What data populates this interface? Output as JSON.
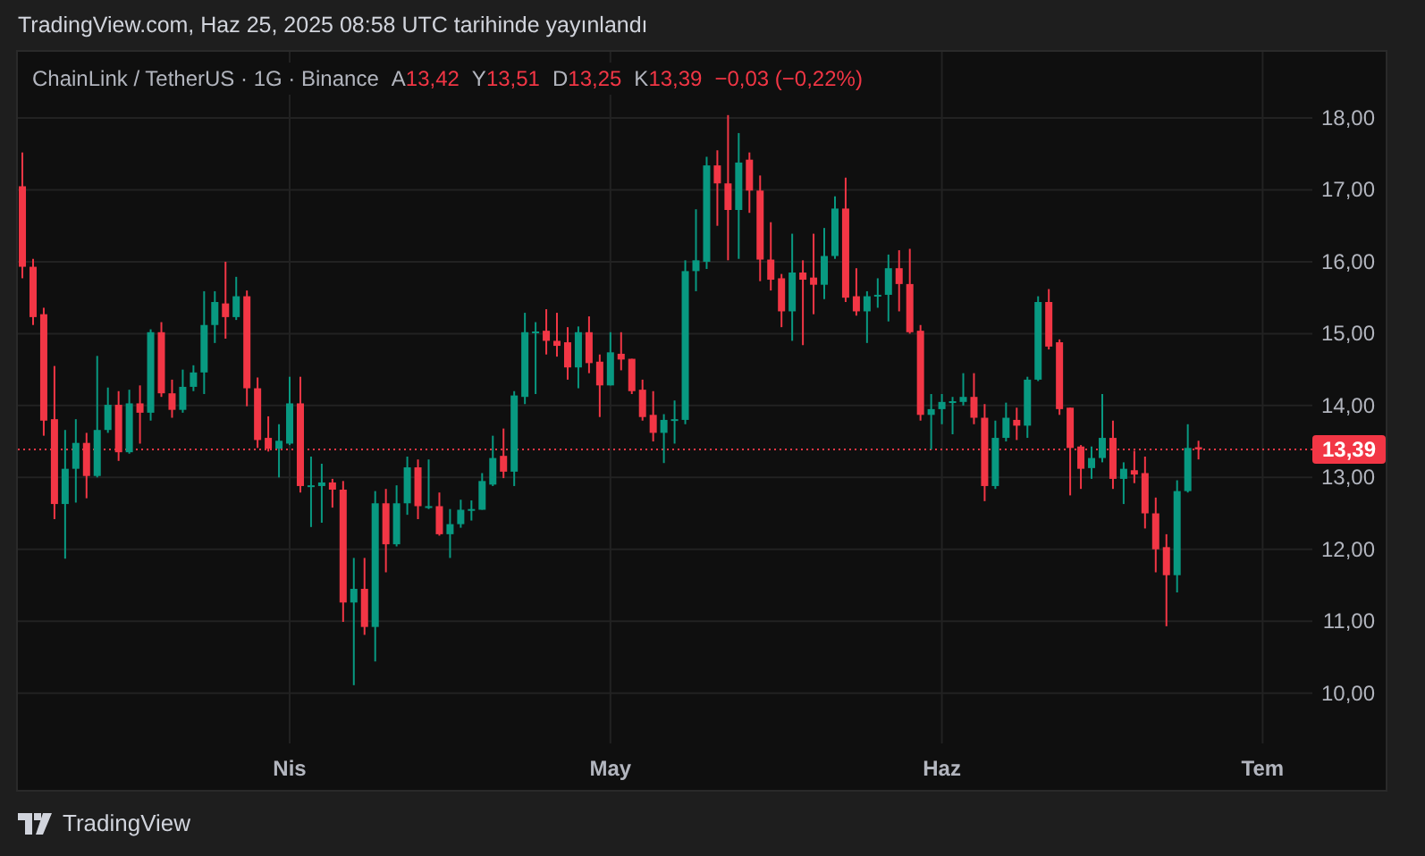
{
  "header": {
    "title": "TradingView.com, Haz 25, 2025 08:58 UTC tarihinde yayınlandı"
  },
  "chart": {
    "symbol": "ChainLink / TetherUS · 1G · Binance",
    "ohlc": [
      {
        "label": "A",
        "value": "13,42"
      },
      {
        "label": "Y",
        "value": "13,51"
      },
      {
        "label": "D",
        "value": "13,25"
      },
      {
        "label": "K",
        "value": "13,39"
      }
    ],
    "change": "−0,03 (−0,22%)",
    "last_price_label": "13,39",
    "chart_data": {
      "type": "candlestick",
      "ylim": [
        9.3,
        18.92
      ],
      "grid": true,
      "yticks": [
        {
          "value": 18,
          "label": "18,00"
        },
        {
          "value": 17,
          "label": "17,00"
        },
        {
          "value": 16,
          "label": "16,00"
        },
        {
          "value": 15,
          "label": "15,00"
        },
        {
          "value": 14,
          "label": "14,00"
        },
        {
          "value": 13,
          "label": "13,00"
        },
        {
          "value": 12,
          "label": "12,00"
        },
        {
          "value": 11,
          "label": "11,00"
        },
        {
          "value": 10,
          "label": "10,00"
        }
      ],
      "categories": [
        null,
        null,
        null,
        null,
        null,
        null,
        null,
        null,
        null,
        null,
        null,
        null,
        null,
        null,
        null,
        null,
        null,
        null,
        null,
        null,
        null,
        null,
        null,
        null,
        null,
        "Nis",
        null,
        null,
        null,
        null,
        null,
        null,
        null,
        null,
        null,
        null,
        null,
        null,
        null,
        null,
        null,
        null,
        null,
        null,
        null,
        null,
        null,
        null,
        null,
        null,
        null,
        null,
        null,
        null,
        null,
        "May",
        null,
        null,
        null,
        null,
        null,
        null,
        null,
        null,
        null,
        null,
        null,
        null,
        null,
        null,
        null,
        null,
        null,
        null,
        null,
        null,
        null,
        null,
        null,
        null,
        null,
        null,
        null,
        null,
        null,
        null,
        "Haz",
        null,
        null,
        null,
        null,
        null,
        null,
        null,
        null,
        null,
        null,
        null,
        null,
        null,
        null,
        null,
        null,
        null,
        null,
        null,
        null,
        null,
        null,
        null,
        null,
        null,
        null,
        null,
        null,
        null,
        "Tem",
        null,
        null,
        null,
        null
      ],
      "ref_lines": [
        {
          "axis": "y",
          "value": 13.39
        }
      ],
      "ohlc": [
        [
          17.05,
          17.52,
          15.77,
          15.93
        ],
        [
          15.93,
          16.04,
          15.12,
          15.23
        ],
        [
          15.27,
          15.36,
          13.58,
          13.79
        ],
        [
          13.81,
          14.55,
          12.42,
          12.63
        ],
        [
          12.63,
          13.66,
          11.87,
          13.12
        ],
        [
          13.12,
          13.81,
          12.65,
          13.48
        ],
        [
          13.48,
          13.62,
          12.71,
          13.02
        ],
        [
          13.02,
          14.69,
          13.0,
          13.66
        ],
        [
          13.66,
          14.25,
          13.62,
          14.01
        ],
        [
          14.01,
          14.2,
          13.23,
          13.35
        ],
        [
          13.35,
          14.22,
          13.33,
          14.03
        ],
        [
          14.03,
          14.28,
          13.47,
          13.9
        ],
        [
          13.9,
          15.06,
          13.79,
          15.02
        ],
        [
          15.02,
          15.16,
          14.12,
          14.17
        ],
        [
          14.17,
          14.36,
          13.83,
          13.94
        ],
        [
          13.94,
          14.5,
          13.9,
          14.26
        ],
        [
          14.26,
          14.56,
          14.2,
          14.46
        ],
        [
          14.46,
          15.59,
          14.16,
          15.12
        ],
        [
          15.12,
          15.59,
          14.87,
          15.44
        ],
        [
          15.42,
          16.0,
          14.93,
          15.23
        ],
        [
          15.23,
          15.79,
          15.19,
          15.52
        ],
        [
          15.52,
          15.6,
          13.99,
          14.24
        ],
        [
          14.24,
          14.39,
          13.41,
          13.52
        ],
        [
          13.55,
          13.85,
          13.36,
          13.4
        ],
        [
          13.4,
          13.74,
          13.0,
          13.51
        ],
        [
          13.47,
          14.4,
          13.45,
          14.03
        ],
        [
          14.03,
          14.4,
          12.79,
          12.88
        ],
        [
          12.88,
          13.29,
          12.31,
          12.89
        ],
        [
          12.88,
          13.19,
          12.37,
          12.93
        ],
        [
          12.93,
          12.98,
          12.58,
          12.83
        ],
        [
          12.83,
          12.95,
          10.99,
          11.26
        ],
        [
          11.26,
          11.88,
          10.11,
          11.45
        ],
        [
          11.45,
          11.88,
          10.81,
          10.92
        ],
        [
          10.92,
          12.81,
          10.44,
          12.64
        ],
        [
          12.64,
          12.84,
          11.68,
          12.07
        ],
        [
          12.07,
          12.89,
          12.04,
          12.64
        ],
        [
          12.64,
          13.29,
          12.48,
          13.14
        ],
        [
          13.14,
          13.25,
          12.42,
          12.6
        ],
        [
          12.58,
          13.25,
          12.56,
          12.6
        ],
        [
          12.6,
          12.79,
          12.19,
          12.21
        ],
        [
          12.21,
          12.56,
          11.88,
          12.35
        ],
        [
          12.35,
          12.69,
          12.3,
          12.55
        ],
        [
          12.55,
          12.68,
          12.4,
          12.56
        ],
        [
          12.55,
          13.06,
          12.55,
          12.95
        ],
        [
          12.9,
          13.58,
          12.88,
          13.27
        ],
        [
          13.3,
          13.68,
          12.99,
          13.08
        ],
        [
          13.08,
          14.2,
          12.88,
          14.14
        ],
        [
          14.12,
          15.29,
          14.02,
          15.02
        ],
        [
          15.02,
          15.16,
          14.16,
          15.03
        ],
        [
          15.04,
          15.34,
          14.71,
          14.9
        ],
        [
          14.9,
          15.29,
          14.68,
          14.83
        ],
        [
          14.88,
          15.09,
          14.36,
          14.53
        ],
        [
          14.53,
          15.1,
          14.24,
          15.02
        ],
        [
          15.02,
          15.24,
          14.45,
          14.59
        ],
        [
          14.61,
          14.71,
          13.84,
          14.28
        ],
        [
          14.28,
          15.02,
          14.28,
          14.74
        ],
        [
          14.72,
          15.02,
          14.49,
          14.64
        ],
        [
          14.65,
          14.65,
          14.16,
          14.2
        ],
        [
          14.22,
          14.36,
          13.79,
          13.84
        ],
        [
          13.87,
          14.2,
          13.5,
          13.62
        ],
        [
          13.62,
          13.88,
          13.2,
          13.8
        ],
        [
          13.8,
          14.07,
          13.47,
          13.81
        ],
        [
          13.8,
          16.02,
          13.74,
          15.87
        ],
        [
          15.87,
          16.73,
          15.59,
          16.02
        ],
        [
          16.0,
          17.46,
          15.9,
          17.34
        ],
        [
          17.34,
          17.55,
          16.5,
          17.09
        ],
        [
          17.09,
          18.04,
          16.02,
          16.72
        ],
        [
          16.72,
          17.79,
          16.04,
          17.38
        ],
        [
          17.42,
          17.52,
          16.68,
          16.99
        ],
        [
          16.99,
          17.2,
          15.73,
          16.03
        ],
        [
          16.03,
          16.55,
          15.6,
          15.75
        ],
        [
          15.77,
          15.83,
          15.09,
          15.31
        ],
        [
          15.31,
          16.39,
          14.9,
          15.85
        ],
        [
          15.85,
          16.02,
          14.84,
          15.75
        ],
        [
          15.78,
          16.39,
          15.27,
          15.68
        ],
        [
          15.68,
          16.47,
          15.48,
          16.08
        ],
        [
          16.08,
          16.91,
          16.04,
          16.74
        ],
        [
          16.74,
          17.17,
          15.44,
          15.5
        ],
        [
          15.52,
          15.91,
          15.25,
          15.31
        ],
        [
          15.31,
          15.59,
          14.87,
          15.52
        ],
        [
          15.53,
          15.77,
          15.36,
          15.54
        ],
        [
          15.54,
          16.1,
          15.17,
          15.91
        ],
        [
          15.91,
          16.16,
          15.31,
          15.69
        ],
        [
          15.69,
          16.18,
          15.0,
          15.02
        ],
        [
          15.04,
          15.12,
          13.79,
          13.87
        ],
        [
          13.87,
          14.16,
          13.39,
          13.95
        ],
        [
          13.95,
          14.16,
          13.74,
          14.05
        ],
        [
          14.05,
          14.12,
          13.6,
          14.06
        ],
        [
          14.05,
          14.45,
          14.0,
          14.12
        ],
        [
          14.12,
          14.45,
          13.74,
          13.83
        ],
        [
          13.83,
          14.02,
          12.67,
          12.88
        ],
        [
          12.88,
          13.79,
          12.84,
          13.55
        ],
        [
          13.55,
          14.04,
          13.5,
          13.83
        ],
        [
          13.8,
          13.97,
          13.52,
          13.72
        ],
        [
          13.72,
          14.4,
          13.55,
          14.36
        ],
        [
          14.36,
          15.52,
          14.34,
          15.44
        ],
        [
          15.44,
          15.62,
          14.78,
          14.82
        ],
        [
          14.88,
          14.92,
          13.87,
          13.95
        ],
        [
          13.97,
          13.97,
          12.75,
          13.41
        ],
        [
          13.43,
          13.45,
          12.84,
          13.12
        ],
        [
          13.13,
          13.43,
          12.98,
          13.27
        ],
        [
          13.27,
          14.16,
          13.21,
          13.55
        ],
        [
          13.55,
          13.79,
          12.84,
          12.98
        ],
        [
          12.98,
          13.21,
          12.63,
          13.12
        ],
        [
          13.1,
          13.37,
          12.92,
          13.04
        ],
        [
          13.06,
          13.29,
          12.29,
          12.5
        ],
        [
          12.5,
          12.72,
          11.68,
          12.0
        ],
        [
          12.03,
          12.21,
          10.93,
          11.64
        ],
        [
          11.64,
          12.96,
          11.4,
          12.81
        ],
        [
          12.81,
          13.74,
          12.79,
          13.41
        ],
        [
          13.42,
          13.51,
          13.25,
          13.39
        ],
        null,
        null,
        null,
        null,
        null,
        null,
        null,
        null,
        null,
        null
      ]
    }
  },
  "footer": {
    "brand": "TradingView"
  }
}
